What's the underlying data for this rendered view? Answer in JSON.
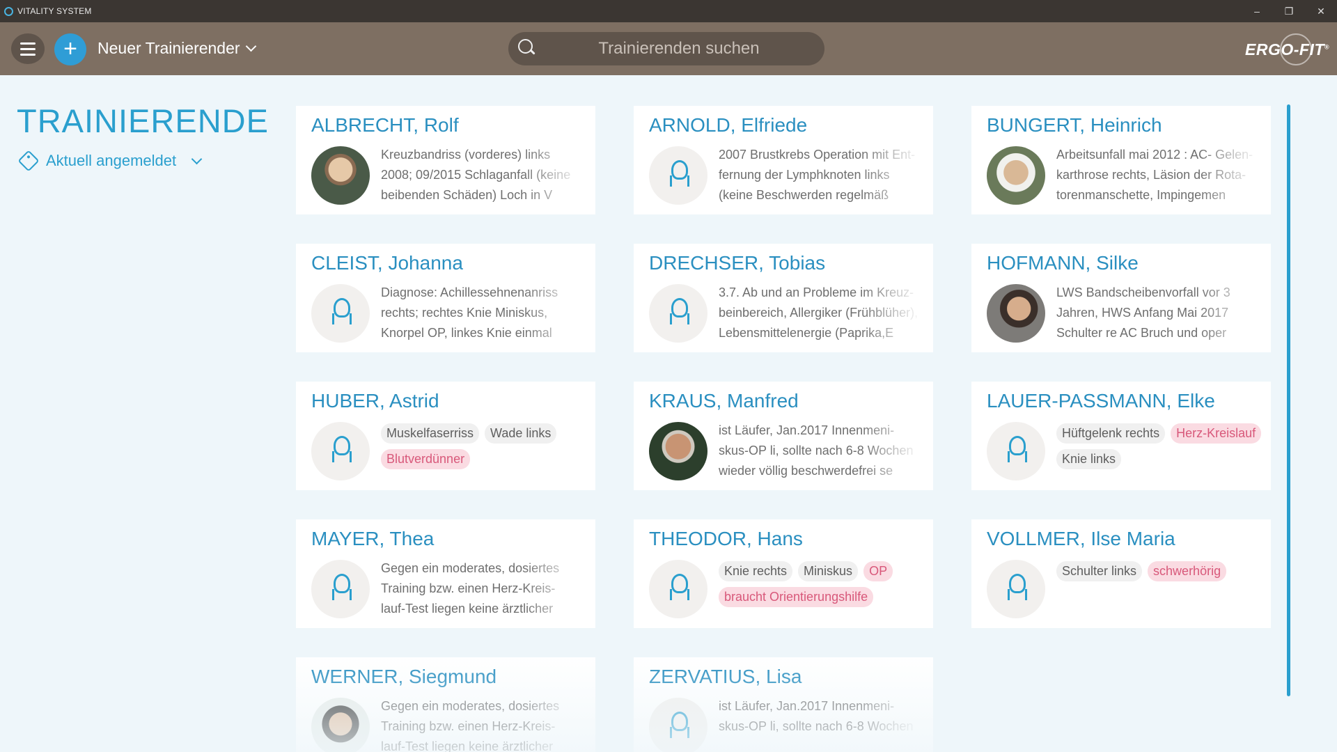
{
  "window": {
    "title": "VITALITY SYSTEM",
    "minimize": "–",
    "maximize": "❐",
    "close": "✕"
  },
  "toolbar": {
    "menu_icon": "hamburger-icon",
    "add_icon": "plus-icon",
    "add_symbol": "+",
    "new_trainee_label": "Neuer Trainierender",
    "search_placeholder": "Trainierenden suchen",
    "logo_text": "ERGO-FIT",
    "logo_mark": "®"
  },
  "sidebar": {
    "title": "TRAINIERENDE",
    "filter_label": "Aktuell angemeldet"
  },
  "colors": {
    "accent": "#2a9fce",
    "topbar": "#7e6f62",
    "titlebar": "#3b3632",
    "warn_tag": "#fadbe2"
  },
  "trainees": [
    {
      "name": "ALBRECHT, Rolf",
      "avatar": "photo",
      "lines": [
        "Kreuzbandriss (vorderes)  links",
        "2008; 09/2015 Schlaganfall (keine",
        "beibenden Schäden) Loch in V"
      ]
    },
    {
      "name": "ARNOLD, Elfriede",
      "avatar": "placeholder",
      "lines": [
        "2007 Brustkrebs Operation mit Ent-",
        "fernung der Lymphknoten links",
        "(keine Beschwerden regelmäß"
      ]
    },
    {
      "name": "BUNGERT, Heinrich",
      "avatar": "photo",
      "lines": [
        "Arbeitsunfall mai 2012 : AC- Gelen-",
        "karthrose rechts, Läsion der Rota-",
        "torenmanschette, Impingemen"
      ]
    },
    {
      "name": "CLEIST, Johanna",
      "avatar": "placeholder",
      "lines": [
        "Diagnose: Achillessehnenanriss",
        "rechts; rechtes Knie Miniskus,",
        "Knorpel OP, linkes Knie einmal"
      ]
    },
    {
      "name": "DRECHSER, Tobias",
      "avatar": "placeholder",
      "lines": [
        "3.7. Ab und an Probleme im Kreuz-",
        "beinbereich, Allergiker (Frühblüher),",
        "Lebensmittelenergie (Paprika,E"
      ]
    },
    {
      "name": "HOFMANN, Silke",
      "avatar": "photo",
      "lines": [
        "LWS Bandscheibenvorfall vor 3",
        "Jahren, HWS Anfang Mai 2017",
        "Schulter re AC Bruch und oper"
      ]
    },
    {
      "name": "HUBER, Astrid",
      "avatar": "placeholder",
      "tags": [
        {
          "text": "Muskelfaserriss",
          "warn": false
        },
        {
          "text": "Wade links",
          "warn": false
        },
        {
          "text": "Blutverdünner",
          "warn": true
        }
      ]
    },
    {
      "name": "KRAUS, Manfred",
      "avatar": "photo",
      "lines": [
        "ist Läufer, Jan.2017 Innenmeni-",
        "skus-OP li, sollte nach 6-8 Wochen",
        "wieder völlig beschwerdefrei se"
      ]
    },
    {
      "name": "LAUER-PASSMANN, Elke",
      "avatar": "placeholder",
      "tags": [
        {
          "text": "Hüftgelenk rechts",
          "warn": false
        },
        {
          "text": "Herz-Kreislauf",
          "warn": true
        },
        {
          "text": "Knie links",
          "warn": false
        }
      ]
    },
    {
      "name": "MAYER, Thea",
      "avatar": "placeholder",
      "lines": [
        "Gegen ein moderates, dosiertes",
        "Training bzw. einen Herz-Kreis-",
        "lauf-Test liegen keine ärztlicher"
      ]
    },
    {
      "name": "THEODOR, Hans",
      "avatar": "placeholder",
      "tags": [
        {
          "text": "Knie rechts",
          "warn": false
        },
        {
          "text": "Miniskus",
          "warn": false
        },
        {
          "text": "OP",
          "warn": true
        },
        {
          "text": "braucht Orientierungshilfe",
          "warn": true
        }
      ]
    },
    {
      "name": "VOLLMER, Ilse Maria",
      "avatar": "placeholder",
      "tags": [
        {
          "text": "Schulter links",
          "warn": false
        },
        {
          "text": "schwerhörig",
          "warn": true
        }
      ]
    },
    {
      "name": "WERNER, Siegmund",
      "avatar": "photo",
      "lines": [
        "Gegen ein moderates, dosiertes",
        "Training bzw. einen Herz-Kreis-",
        "lauf-Test liegen keine ärztlicher"
      ]
    },
    {
      "name": "ZERVATIUS, Lisa",
      "avatar": "placeholder",
      "lines": [
        "ist Läufer, Jan.2017 Innenmeni-",
        "skus-OP li, sollte nach 6-8 Wochen"
      ]
    }
  ]
}
